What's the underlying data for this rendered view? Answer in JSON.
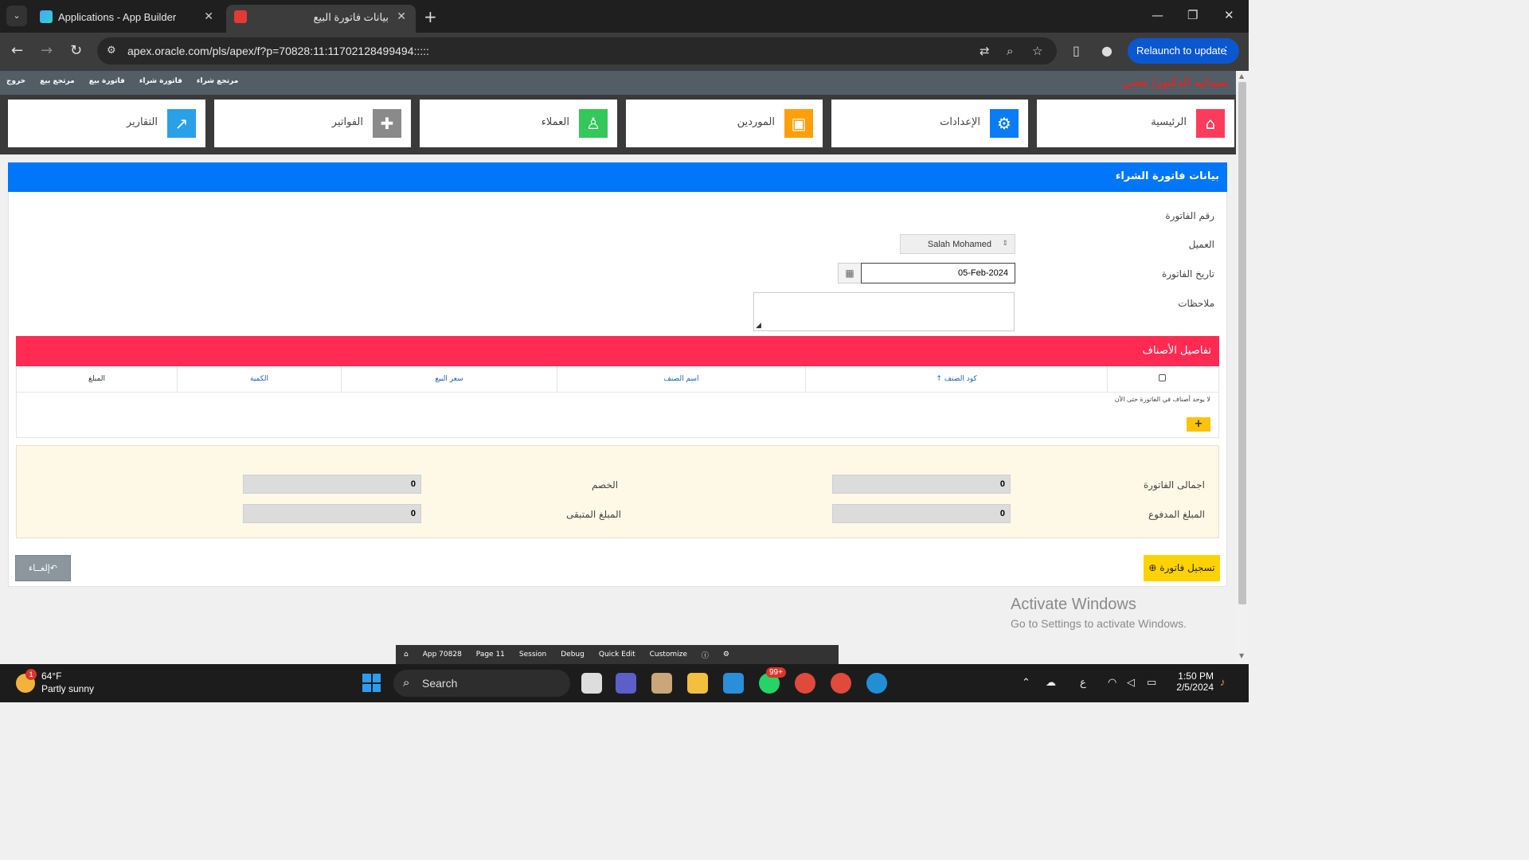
{
  "browser": {
    "tabs": [
      {
        "title": "Applications - App Builder"
      },
      {
        "title": "بيانات فاتورة البيع"
      }
    ],
    "url": "apex.oracle.com/pls/apex/f?p=70828:11:11702128499494:::::",
    "relaunch_label": "Relaunch to update"
  },
  "app": {
    "brand": "صيدليه الدكتور/ معني",
    "menu": [
      "خروج",
      "مرتجع بيع",
      "فاتورة بيع",
      "فاتورة شراء",
      "مرتجع شراء"
    ],
    "cards": [
      {
        "label": "الرئيسية",
        "icon": "home-icon",
        "color": "#ff3b5c"
      },
      {
        "label": "الإعدادات",
        "icon": "gear-icon",
        "color": "#0a7cf5"
      },
      {
        "label": "الموردين",
        "icon": "bus-icon",
        "color": "#ff9f0a"
      },
      {
        "label": "العملاء",
        "icon": "person-icon",
        "color": "#34c759"
      },
      {
        "label": "الفواتير",
        "icon": "ambulance-icon",
        "color": "#8a8a8a"
      },
      {
        "label": "التقارير",
        "icon": "chart-icon",
        "color": "#2aa0e8"
      }
    ]
  },
  "form": {
    "region_title": "بيانات فاتورة الشراء",
    "invoice_number_label": "رقم الفاتورة",
    "customer_label": "العميل",
    "customer_value": "Salah Mohamed",
    "date_label": "تاريخ الفاتورة",
    "date_value": "05-Feb-2024",
    "notes_label": "ملاحظات"
  },
  "items": {
    "title": "تفاصيل الأصناف",
    "columns": [
      "كود الصنف",
      "اسم الصنف",
      "سعر البيع",
      "الكمية",
      "المبلغ"
    ],
    "no_data": "لا يوجد أصناف في الفاتورة حتى الآن",
    "add_label": "+"
  },
  "totals": {
    "invoice_total_label": "اجمالى الفاتورة",
    "invoice_total_value": "0",
    "discount_label": "الخصم",
    "discount_value": "0",
    "paid_label": "المبلغ المدفوع",
    "paid_value": "0",
    "remaining_label": "المبلغ المتبقى",
    "remaining_value": "0"
  },
  "actions": {
    "save_label": "تسجيل فاتورة",
    "cancel_label": "إلغــاء"
  },
  "watermark": {
    "line1": "Activate Windows",
    "line2": "Go to Settings to activate Windows."
  },
  "devbar": [
    "App 70828",
    "Page 11",
    "Session",
    "Debug",
    "Quick Edit",
    "Customize"
  ],
  "taskbar": {
    "temp": "64°F",
    "condition": "Partly sunny",
    "weather_badge": "1",
    "search_label": "Search",
    "whatsapp_badge": "99+",
    "lang": "ع",
    "time": "1:50 PM",
    "date": "2/5/2024"
  }
}
